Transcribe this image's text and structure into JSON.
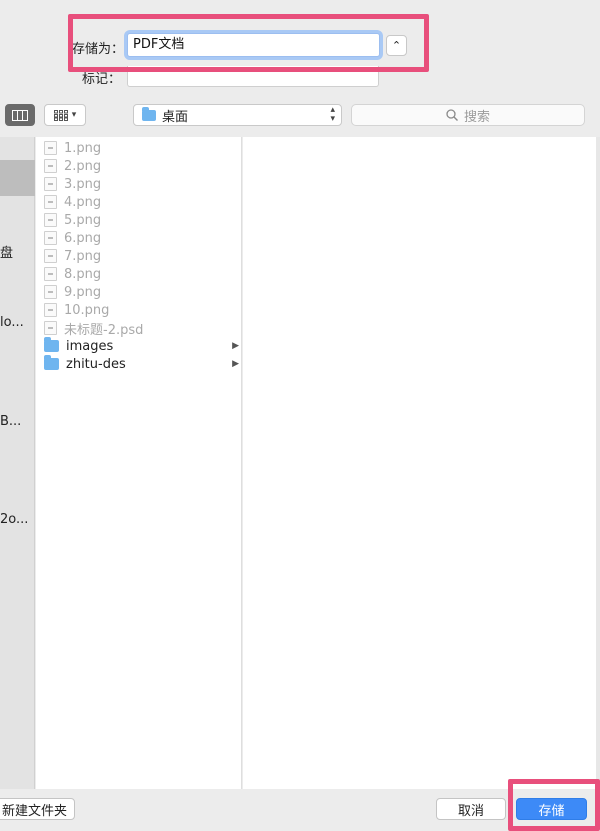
{
  "save_form": {
    "save_as_label": "存储为：",
    "filename_value": "PDF文档",
    "tags_label": "标记：",
    "tags_value": ""
  },
  "toolbar": {
    "location": "桌面",
    "search_placeholder": "搜索"
  },
  "sidebar": {
    "fragments": [
      "盘",
      "lo...",
      "B...",
      "2o..."
    ]
  },
  "files": [
    {
      "name": "1.png",
      "type": "file",
      "enabled": false
    },
    {
      "name": "2.png",
      "type": "file",
      "enabled": false
    },
    {
      "name": "3.png",
      "type": "file",
      "enabled": false
    },
    {
      "name": "4.png",
      "type": "file",
      "enabled": false
    },
    {
      "name": "5.png",
      "type": "file",
      "enabled": false
    },
    {
      "name": "6.png",
      "type": "file",
      "enabled": false
    },
    {
      "name": "7.png",
      "type": "file",
      "enabled": false
    },
    {
      "name": "8.png",
      "type": "file",
      "enabled": false
    },
    {
      "name": "9.png",
      "type": "file",
      "enabled": false
    },
    {
      "name": "10.png",
      "type": "file",
      "enabled": false
    },
    {
      "name": "未标题-2.psd",
      "type": "file",
      "enabled": false
    },
    {
      "name": "images",
      "type": "folder",
      "enabled": true
    },
    {
      "name": "zhitu-des",
      "type": "folder",
      "enabled": true
    }
  ],
  "footer": {
    "new_folder": "新建文件夹",
    "cancel": "取消",
    "save": "存储"
  },
  "colors": {
    "highlight": "#e84f7c",
    "accent": "#3d8af7",
    "folder": "#6fb5ef"
  }
}
